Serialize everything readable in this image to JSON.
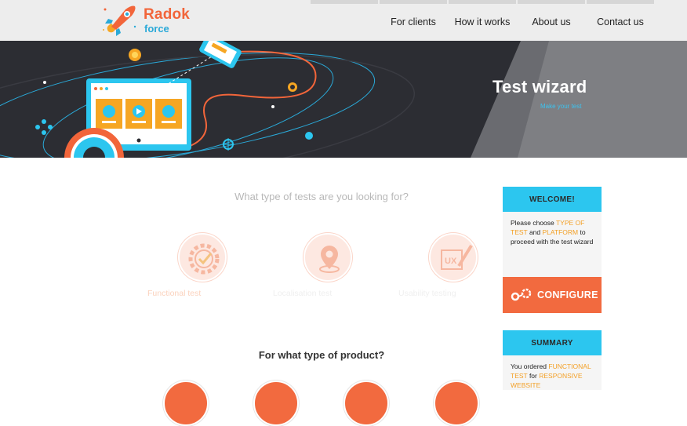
{
  "logo": {
    "line1": "Radok",
    "line2": "force"
  },
  "nav": [
    "For clients",
    "How it works",
    "About us",
    "Contact us"
  ],
  "hero": {
    "title": "Test wizard",
    "subtitle": "Make your test"
  },
  "tests": {
    "question": "What type of tests are you looking for?",
    "options": [
      {
        "label": "Functional test",
        "icon": "gear-check-icon",
        "selected": true
      },
      {
        "label": "Localisation test",
        "icon": "map-pin-icon",
        "selected": false
      },
      {
        "label": "Usability testing",
        "icon": "ux-pencil-icon",
        "selected": false
      }
    ]
  },
  "products": {
    "question": "For what type of product?"
  },
  "welcome": {
    "title": "WELCOME!",
    "text_1": "Please choose ",
    "hl_1": "TYPE OF TEST",
    "text_2": " and ",
    "hl_2": "PLATFORM",
    "text_3": " to proceed with the test wizard"
  },
  "configure_label": "CONFIGURE",
  "summary": {
    "title": "SUMMARY",
    "text_1": "You ordered ",
    "hl_1": "FUNCTIONAL TEST",
    "text_2": " for ",
    "hl_2": "RESPONSIVE WEBSITE"
  },
  "colors": {
    "accent": "#f26a3f",
    "cyan": "#2cc6ef",
    "hero_bg": "#2c2d33",
    "highlight": "#f4a026"
  }
}
